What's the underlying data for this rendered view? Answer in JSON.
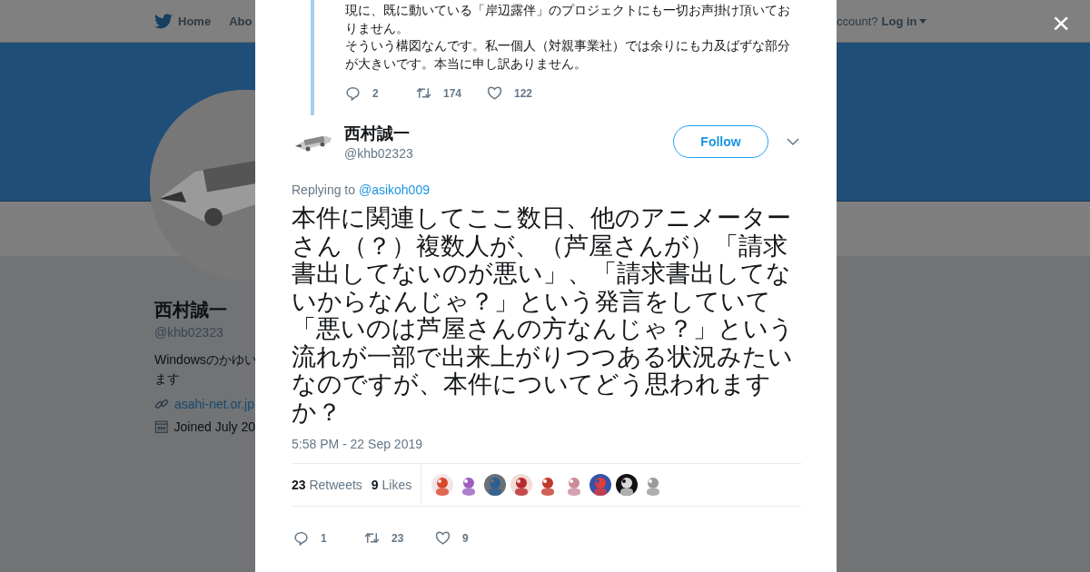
{
  "background_page": {
    "nav": {
      "home": "Home",
      "about": "Abo",
      "account_prompt": "ccount?",
      "login": "Log in"
    },
    "profile": {
      "name": "西村誠一",
      "handle": "@khb02323",
      "bio": [
        "Windowsのかゆい",
        "ます"
      ],
      "link": "asahi-net.or.jp",
      "joined": "Joined July 20"
    }
  },
  "modal": {
    "close": "×",
    "parent_tweet": {
      "paragraphs": [
        "現に、既に動いている「岸辺露伴」のプロジェクトにも一切お声掛け頂いておりません。",
        "そういう構図なんです。私一個人（対親事業社）では余りにも力及ばずな部分が大きいです。本当に申し訳ありません。"
      ],
      "replies": "2",
      "retweets": "174",
      "likes": "122"
    },
    "tweet": {
      "name": "西村誠一",
      "handle": "@khb02323",
      "follow": "Follow",
      "replying_label": "Replying to",
      "replying_to": "@asikoh009",
      "text": "本件に関連してここ数日、他のアニメーターさん（？）複数人が、（芦屋さんが）「請求書出してないのが悪い」、「請求書出してないからなんじゃ？」という発言をしていて「悪いのは芦屋さんの方なんじゃ？」という流れが一部で出来上がりつつある状況みたいなのですが、本件についてどう思われますか？",
      "time": "5:58 PM - 22 Sep 2019",
      "retweet_count": "23",
      "retweet_label": "Retweets",
      "like_count": "9",
      "like_label": "Likes",
      "replies": "1",
      "retweets": "23",
      "likes": "9"
    }
  }
}
